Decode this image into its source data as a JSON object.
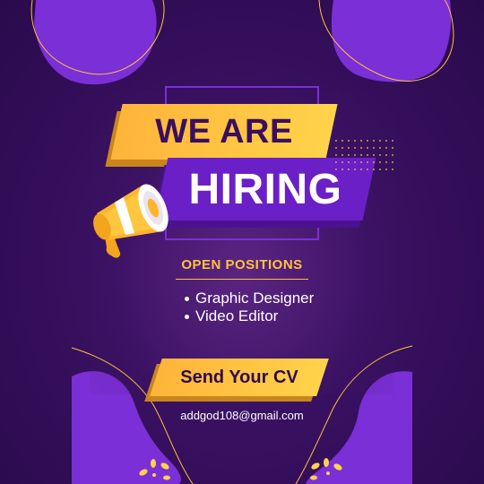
{
  "poster": {
    "headline_top": "WE ARE",
    "headline_bottom": "HIRING",
    "positions_heading": "OPEN POSITIONS",
    "positions": [
      "Graphic Designer",
      "Video Editor"
    ],
    "cta_label": "Send Your CV",
    "email": "addgod108@gmail.com"
  },
  "icons": {
    "megaphone": "megaphone-icon",
    "sparkle_left": "sparkle-icon",
    "sparkle_right": "sparkle-icon",
    "bullet": "bullet-dot-icon"
  },
  "colors": {
    "background": "#2e0b52",
    "accent_purple": "#6b1fc7",
    "blob_purple": "#7b2fd6",
    "accent_yellow": "#ffc23d",
    "text_dark": "#3a0f5e",
    "text_light": "#ffffff"
  }
}
